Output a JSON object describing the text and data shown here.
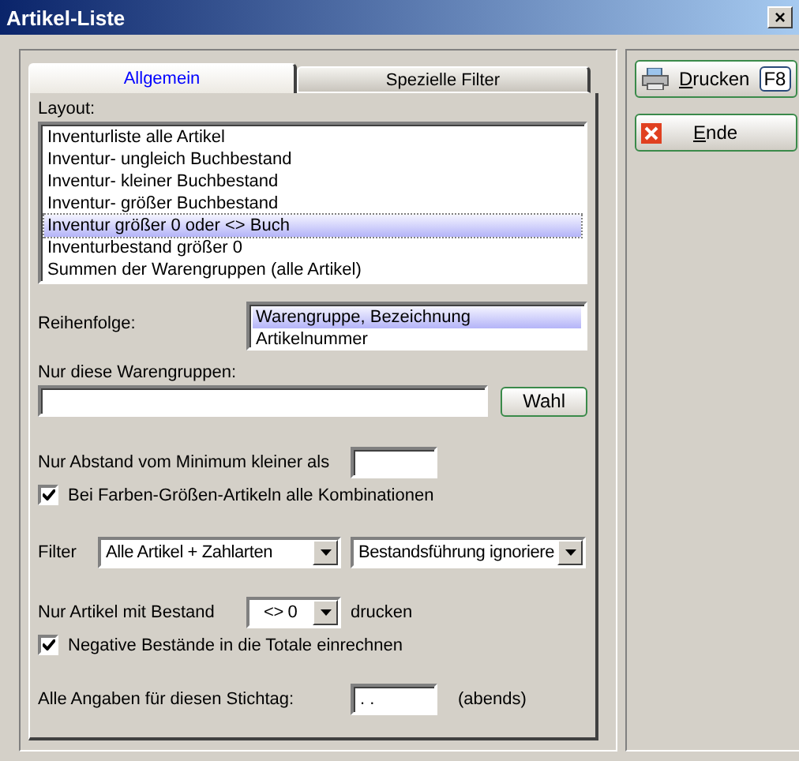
{
  "window": {
    "title": "Artikel-Liste",
    "close": "×"
  },
  "tabs": [
    {
      "label": "Allgemein",
      "selected": true
    },
    {
      "label": "Spezielle Filter",
      "selected": false
    }
  ],
  "layout": {
    "label": "Layout:",
    "items": [
      {
        "label": "Inventurliste alle Artikel",
        "selected": false
      },
      {
        "label": "Inventur- ungleich Buchbestand",
        "selected": false
      },
      {
        "label": "Inventur- kleiner Buchbestand",
        "selected": false
      },
      {
        "label": "Inventur- größer Buchbestand",
        "selected": false
      },
      {
        "label": "Inventur größer 0 oder <> Buch",
        "selected": true
      },
      {
        "label": "Inventurbestand größer 0",
        "selected": false
      },
      {
        "label": "Summen der Warengruppen (alle Artikel)",
        "selected": false
      }
    ]
  },
  "order": {
    "label": "Reihenfolge:",
    "items": [
      {
        "label": "Warengruppe, Bezeichnung",
        "selected": true
      },
      {
        "label": "Artikelnummer",
        "selected": false
      }
    ]
  },
  "groups": {
    "label": "Nur diese Warengruppen:",
    "button": "Wahl"
  },
  "minimum": {
    "label": "Nur Abstand vom Minimum kleiner als"
  },
  "combos": {
    "label": "Bei Farben-Größen-Artikeln alle Kombinationen",
    "checked": true
  },
  "filter": {
    "label": "Filter",
    "select_1": "Alle Artikel + Zahlarten",
    "select_2": "Bestandsführung ignoriere"
  },
  "stock": {
    "label": "Nur Artikel mit Bestand",
    "select": "<> 0",
    "suffix": "drucken"
  },
  "negative": {
    "label": "Negative Bestände in die Totale einrechnen",
    "checked": true
  },
  "date": {
    "label": "Alle Angaben für diesen Stichtag:",
    "value": ". .",
    "suffix": "(abends)"
  },
  "buttons": [
    {
      "kind": "print",
      "label": "Drucken",
      "key": "F8"
    },
    {
      "kind": "close",
      "label": "Ende"
    }
  ]
}
